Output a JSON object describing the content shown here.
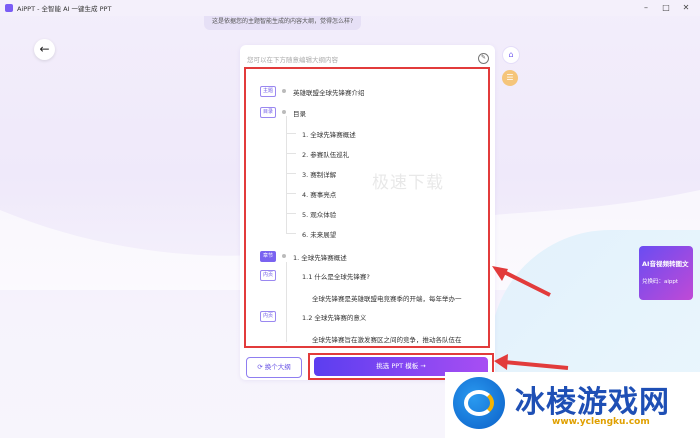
{
  "window": {
    "title": "AiPPT - 全智能 AI 一键生成 PPT",
    "controls": [
      "minimize-icon",
      "maximize-icon",
      "close-icon"
    ]
  },
  "chat": {
    "bubble_text": "这是依据您的主题智能生成的内容大纲，觉得怎么样?"
  },
  "panel": {
    "header_hint": "您可以在下方随意编辑大纲内容",
    "outline": [
      {
        "tag": "主题",
        "text": "英雄联盟全球先锋赛介绍"
      },
      {
        "tag": "目录",
        "text": "目录"
      },
      {
        "text": "1. 全球先锋赛概述"
      },
      {
        "text": "2. 参赛队伍巡礼"
      },
      {
        "text": "3. 赛制详解"
      },
      {
        "text": "4. 赛事亮点"
      },
      {
        "text": "5. 观众体验"
      },
      {
        "text": "6. 未来展望"
      },
      {
        "tag": "章节",
        "text": "1. 全球先锋赛概述"
      },
      {
        "tag": "内页",
        "text": "1.1 什么是全球先锋赛?"
      },
      {
        "text": "全球先锋赛是英雄联盟电竞赛季的开端，每年举办一"
      },
      {
        "tag": "内页",
        "text": "1.2 全球先锋赛的意义"
      },
      {
        "text": "全球先锋赛旨在激发赛区之间的竞争，推动各队伍在"
      }
    ],
    "watermark": "极速下载"
  },
  "actions": {
    "switch_outline": "换个大纲",
    "pick_template": "挑选 PPT 模板 →"
  },
  "promo": {
    "title": "AI音视频转图文",
    "code": "兑换码：aippt"
  },
  "brand": {
    "name": "冰棱游戏网",
    "url": "www.yclengku.com"
  },
  "colors": {
    "accent": "#6a4cf2",
    "highlight": "#e23b3b"
  }
}
